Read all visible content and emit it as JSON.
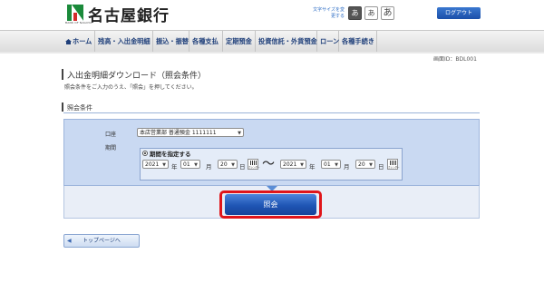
{
  "header": {
    "bank_name": "名古屋銀行",
    "logo_subtext": "BANK OF NAGOYA",
    "font_size_label": "文字サイズを変更する",
    "font_sizes": [
      "あ",
      "あ",
      "あ"
    ],
    "logout_label": "ログアウト"
  },
  "nav": {
    "items": [
      "ホーム",
      "残高・入出金明細",
      "振込・振替",
      "各種支払",
      "定期預金",
      "投資信託・外貨預金",
      "ローン",
      "各種手続き"
    ]
  },
  "screen_id": "画面ID：BDL001",
  "page_title": "入出金明細ダウンロード（照会条件）",
  "instruction": "照会条件をご入力のうえ、「照会」を押してください。",
  "section_heading": "照会条件",
  "form": {
    "account_label": "口座",
    "account_value": "本店営業部 普通預金 1111111",
    "period_label": "期間",
    "period_option": "期間を指定する",
    "from": {
      "year": "2021",
      "month": "01",
      "day": "20"
    },
    "to": {
      "year": "2021",
      "month": "01",
      "day": "20"
    },
    "unit_year": "年",
    "unit_month": "月",
    "unit_day": "日",
    "calendar_caption": "カレンダー",
    "tilde": "～"
  },
  "submit_label": "照会",
  "top_page_link": "トップページへ",
  "colors": {
    "accent_blue": "#1f55b4",
    "highlight_red": "#e0151a",
    "panel_bg": "#c9d9f2"
  }
}
